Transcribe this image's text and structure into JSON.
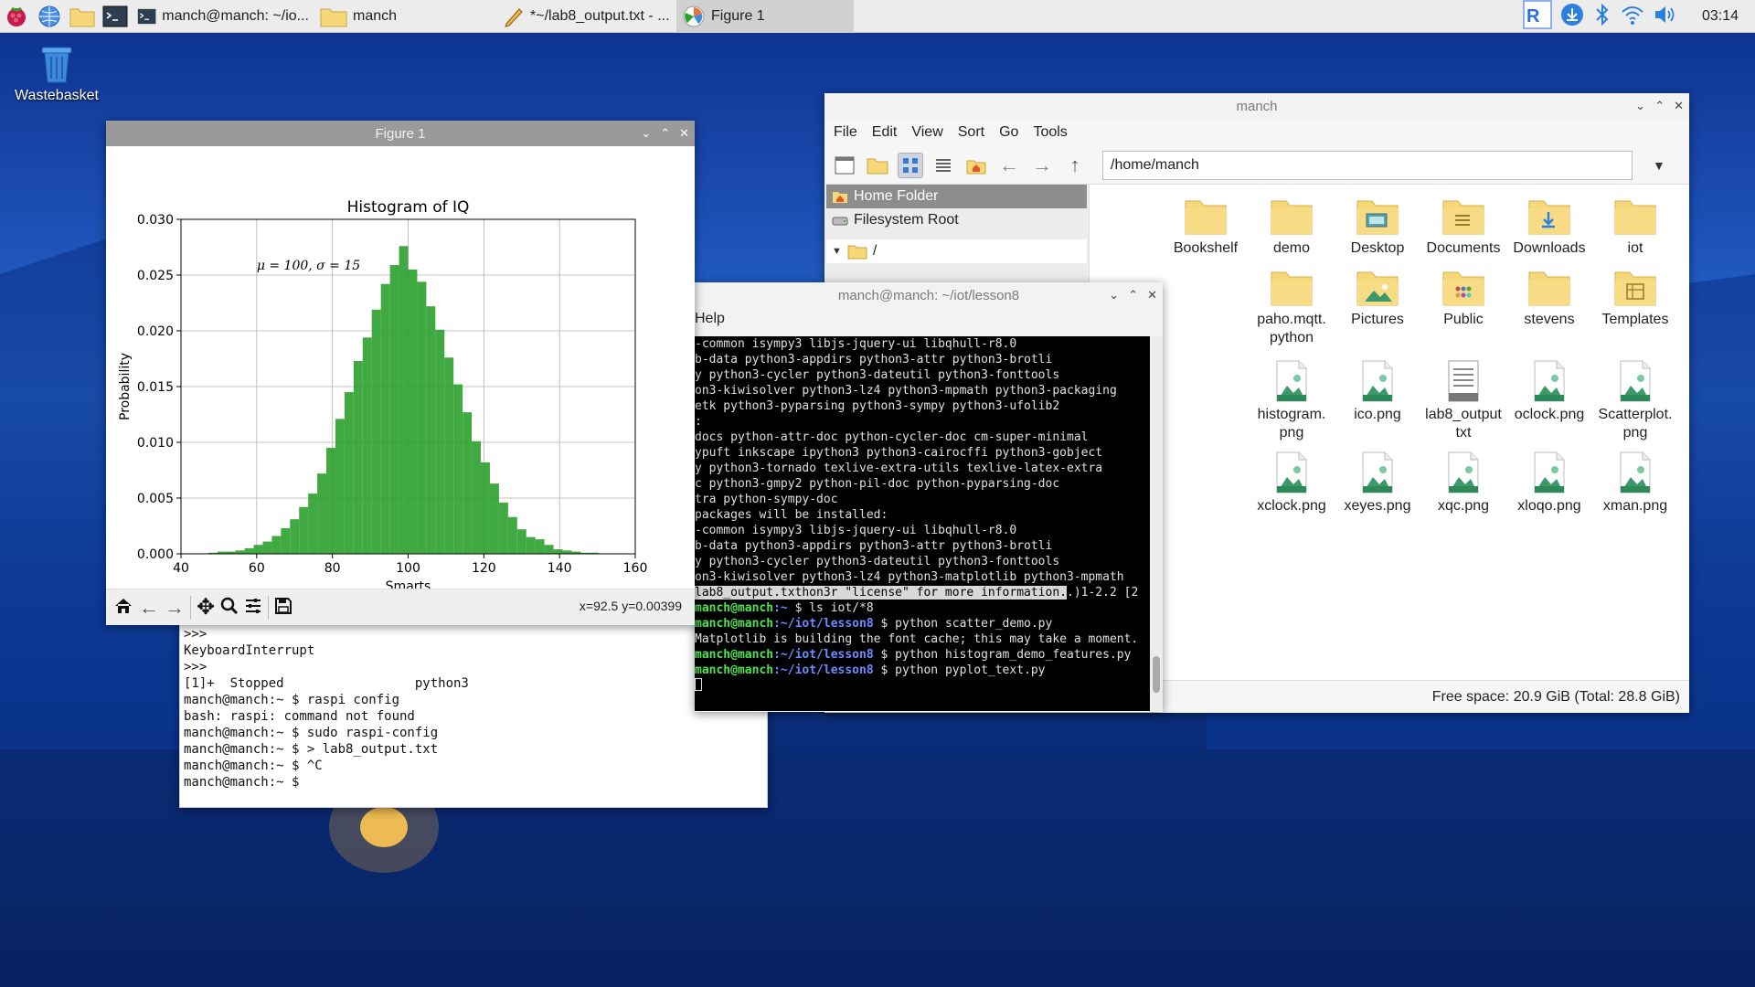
{
  "taskbar": {
    "tasks": [
      {
        "label": "manch@manch: ~/io...",
        "icon": "terminal-icon"
      },
      {
        "label": "manch",
        "icon": "folder-icon"
      },
      {
        "label": "*~/lab8_output.txt - ...",
        "icon": "text-editor-icon"
      },
      {
        "label": "Figure 1",
        "icon": "matplotlib-icon"
      }
    ],
    "clock": "03:14"
  },
  "desktop": {
    "wastebasket_label": "Wastebasket"
  },
  "figure_window": {
    "title": "Figure 1",
    "coords": "x=92.5 y=0.00399"
  },
  "chart_data": {
    "type": "bar",
    "title": "Histogram of IQ",
    "xlabel": "Smarts",
    "ylabel": "Probability",
    "annotation": "μ = 100,  σ = 15",
    "xlim": [
      40,
      160
    ],
    "ylim": [
      0,
      0.03
    ],
    "xticks": [
      "40",
      "60",
      "80",
      "100",
      "120",
      "140",
      "160"
    ],
    "yticks": [
      "0.000",
      "0.005",
      "0.010",
      "0.015",
      "0.020",
      "0.025",
      "0.030"
    ],
    "grid": true,
    "color": "#2ca02c",
    "bin_width": 2.4,
    "bin_starts": [
      40,
      42.4,
      44.8,
      47.2,
      49.6,
      52,
      54.4,
      56.8,
      59.2,
      61.6,
      64,
      66.4,
      68.8,
      71.2,
      73.6,
      76,
      78.4,
      80.8,
      83.2,
      85.6,
      88,
      90.4,
      92.8,
      95.2,
      97.6,
      100,
      102.4,
      104.8,
      107.2,
      109.6,
      112,
      114.4,
      116.8,
      119.2,
      121.6,
      124,
      126.4,
      128.8,
      131.2,
      133.6,
      136,
      138.4,
      140.8,
      143.2,
      145.6,
      148,
      150.4,
      152.8
    ],
    "values": [
      0.0,
      0.0,
      0.0,
      0.0001,
      0.0002,
      0.0002,
      0.0003,
      0.0005,
      0.0008,
      0.0011,
      0.0016,
      0.0023,
      0.0031,
      0.0042,
      0.0054,
      0.0072,
      0.0095,
      0.0121,
      0.0145,
      0.0173,
      0.0194,
      0.0219,
      0.0242,
      0.0259,
      0.0276,
      0.0255,
      0.0244,
      0.0222,
      0.0201,
      0.0176,
      0.0152,
      0.0127,
      0.0101,
      0.0082,
      0.0063,
      0.0046,
      0.0033,
      0.0022,
      0.0015,
      0.0013,
      0.0008,
      0.0004,
      0.0003,
      0.0002,
      0.0001,
      0.0001,
      0.0,
      0.0
    ]
  },
  "term_bottom": {
    "lines": [
      ">>>",
      "KeyboardInterrupt",
      ">>>",
      "[1]+  Stopped                 python3",
      "manch@manch:~ $ raspi config",
      "bash: raspi: command not found",
      "manch@manch:~ $ sudo raspi-config",
      "manch@manch:~ $ > lab8_output.txt",
      "manch@manch:~ $ ^C",
      "manch@manch:~ $"
    ]
  },
  "file_manager": {
    "title": "manch",
    "menu": [
      "File",
      "Edit",
      "View",
      "Sort",
      "Go",
      "Tools"
    ],
    "path": "/home/manch",
    "sidebar": [
      {
        "label": "Home Folder",
        "selected": true
      },
      {
        "label": "Filesystem Root",
        "selected": false
      }
    ],
    "tree_root": "/",
    "files": [
      {
        "label": "Bookshelf",
        "kind": "folder"
      },
      {
        "label": "demo",
        "kind": "folder"
      },
      {
        "label": "Desktop",
        "kind": "folder-desktop"
      },
      {
        "label": "Documents",
        "kind": "folder-documents"
      },
      {
        "label": "Downloads",
        "kind": "folder-downloads"
      },
      {
        "label": "iot",
        "kind": "folder"
      },
      {
        "label": "paho.mqtt.\npython",
        "kind": "folder"
      },
      {
        "label": "Pictures",
        "kind": "folder-pictures"
      },
      {
        "label": "Public",
        "kind": "folder-public"
      },
      {
        "label": "stevens",
        "kind": "folder"
      },
      {
        "label": "Templates",
        "kind": "folder-templates"
      },
      {
        "label": "histogram.\npng",
        "kind": "image"
      },
      {
        "label": "ico.png",
        "kind": "image"
      },
      {
        "label": "lab8_output\ntxt",
        "kind": "text"
      },
      {
        "label": "oclock.png",
        "kind": "image"
      },
      {
        "label": "Scatterplot.\npng",
        "kind": "image"
      },
      {
        "label": "xclock.png",
        "kind": "image"
      },
      {
        "label": "xeyes.png",
        "kind": "image"
      },
      {
        "label": "xqc.png",
        "kind": "image"
      },
      {
        "label": "xloqo.png",
        "kind": "image"
      },
      {
        "label": "xman.png",
        "kind": "image"
      }
    ],
    "status": "Free space: 20.9 GiB (Total: 28.8 GiB)"
  },
  "terminal_lesson8": {
    "title": "manch@manch: ~/iot/lesson8",
    "menu_help": "Help",
    "lines": [
      "-common isympy3 libjs-jquery-ui libqhull-r8.0",
      "b-data python3-appdirs python3-attr python3-brotli",
      "y python3-cycler python3-dateutil python3-fonttools",
      "on3-kiwisolver python3-lz4 python3-mpmath python3-packaging",
      "etk python3-pyparsing python3-sympy python3-ufolib2",
      "",
      ":",
      "docs python-attr-doc python-cycler-doc cm-super-minimal",
      "ypuft inkscape ipython3 python3-cairocffi python3-gobject",
      "y python3-tornado texlive-extra-utils texlive-latex-extra",
      "c python3-gmpy2 python-pil-doc python-pyparsing-doc",
      "tra python-sympy-doc",
      "packages will be installed:",
      "-common isympy3 libjs-jquery-ui libqhull-r8.0",
      "b-data python3-appdirs python3-attr python3-brotli",
      "y python3-cycler python3-dateutil python3-fonttools",
      "on3-kiwisolver python3-lz4 python3-matplotlib python3-mpmath"
    ],
    "highlight_line": {
      "sel": "lab8_output.txthon3r \"license\" for more information.",
      "rest": ".)1-2.2 [2"
    },
    "overlap_line": "manch@manch:~ $ ls iot/*8",
    "prompt_user": "manch@manch",
    "prompt_path": ":~/iot/lesson8 $",
    "commands": [
      "python scatter_demo.py",
      "python histogram_demo_features.py",
      "python pyplot_text.py"
    ],
    "font_cache_msg": "Matplotlib is building the font cache; this may take a moment."
  }
}
